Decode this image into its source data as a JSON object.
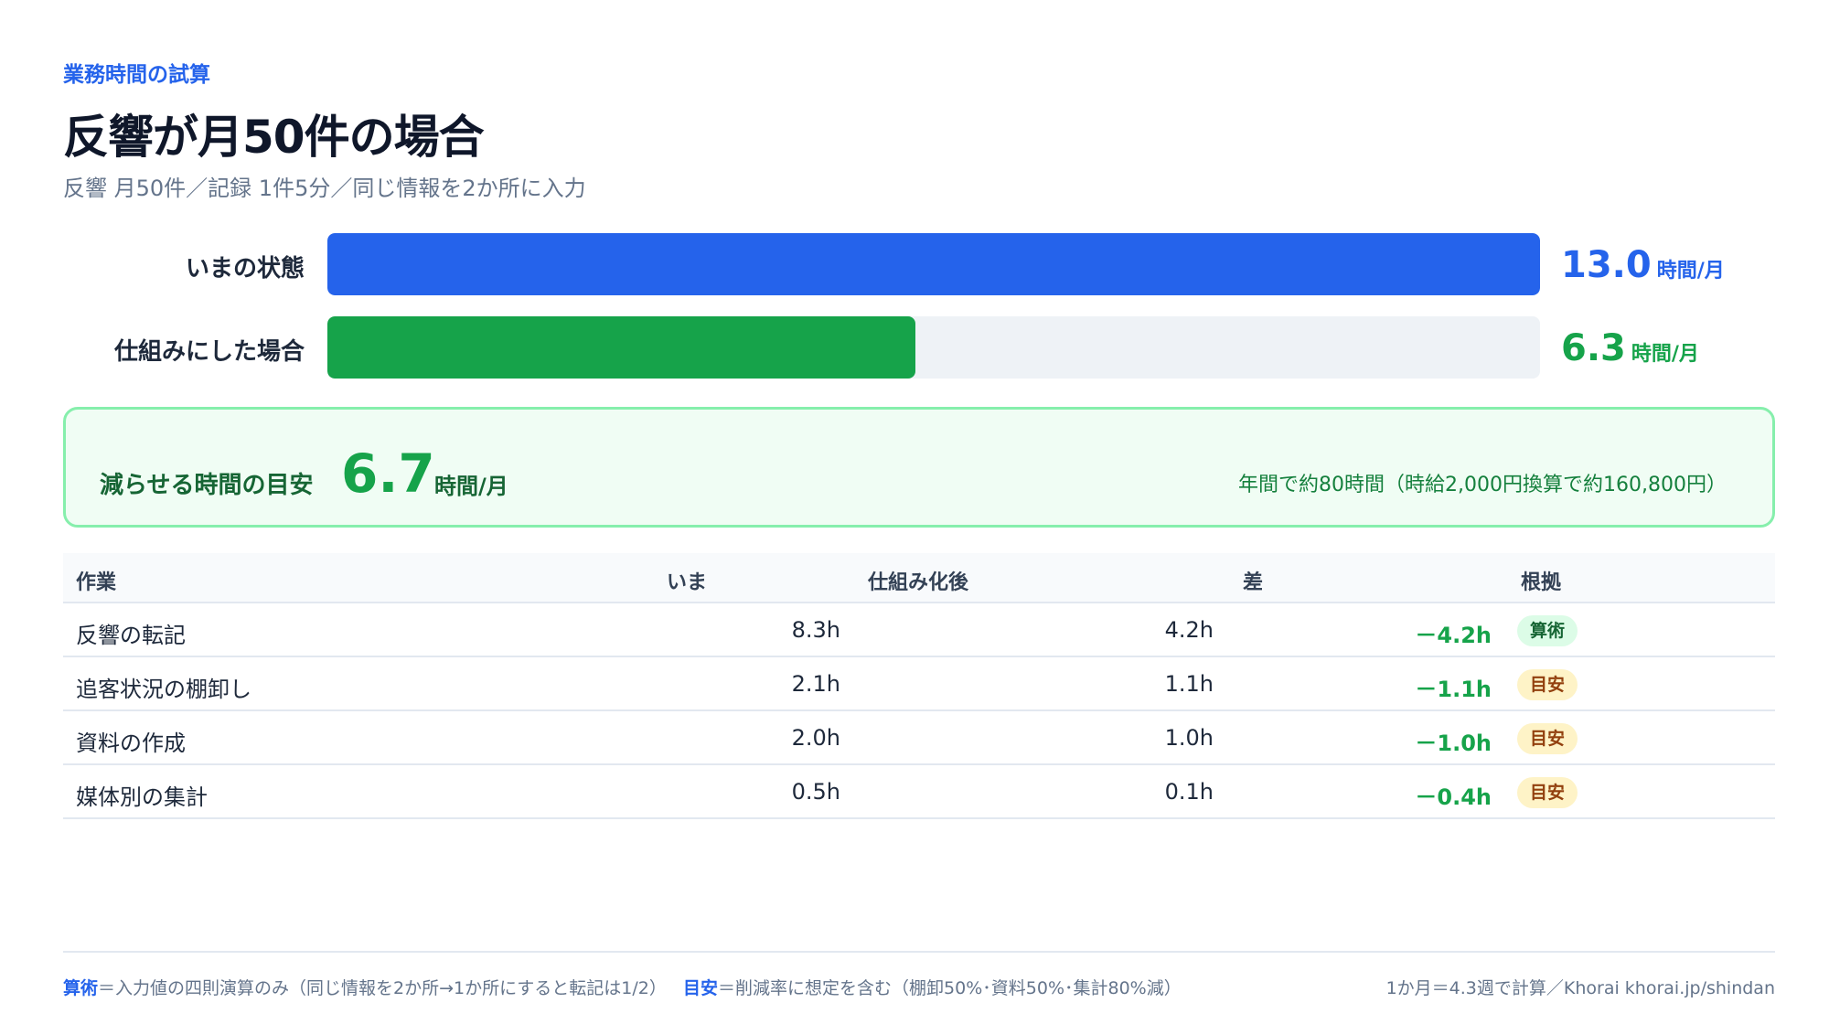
{
  "header": {
    "eyebrow": "業務時間の試算",
    "title": "反響が月50件の場合",
    "subtitle": "反響 月50件／記録 1件5分／同じ情報を2か所に入力"
  },
  "bars": [
    {
      "label": "いまの状態",
      "value": "13.0",
      "unit": "時間/月",
      "fraction": 1.0,
      "color": "#2563eb"
    },
    {
      "label": "仕組みにした場合",
      "value": "6.3",
      "unit": "時間/月",
      "fraction": 0.4846,
      "color": "#16a34a"
    }
  ],
  "summary": {
    "label": "減らせる時間の目安",
    "value": "6.7",
    "unit": "時間/月",
    "note": "年間で約80時間（時給2,000円換算で約160,800円）"
  },
  "table": {
    "headers": {
      "task": "作業",
      "now": "いま",
      "after": "仕組み化後",
      "diff": "差",
      "basis": "根拠"
    },
    "rows": [
      {
        "task": "反響の転記",
        "now": "8.3h",
        "after": "4.2h",
        "diff": "－4.2h",
        "basis": "算術",
        "basis_type": "calc"
      },
      {
        "task": "追客状況の棚卸し",
        "now": "2.1h",
        "after": "1.1h",
        "diff": "－1.1h",
        "basis": "目安",
        "basis_type": "est"
      },
      {
        "task": "資料の作成",
        "now": "2.0h",
        "after": "1.0h",
        "diff": "－1.0h",
        "basis": "目安",
        "basis_type": "est"
      },
      {
        "task": "媒体別の集計",
        "now": "0.5h",
        "after": "0.1h",
        "diff": "－0.4h",
        "basis": "目安",
        "basis_type": "est"
      }
    ]
  },
  "badge_colors": {
    "calc": {
      "bg": "#dcfce7",
      "fg": "#166534"
    },
    "est": {
      "bg": "#fef3c7",
      "fg": "#92400e"
    }
  },
  "footer": {
    "calc_key": "算術",
    "calc_desc": "＝入力値の四則演算のみ（同じ情報を2か所→1か所にすると転記は1/2）",
    "est_key": "目安",
    "est_desc": "＝削減率に想定を含む（棚卸50%･資料50%･集計80%減）",
    "right": "1か月＝4.3週で計算／Khorai khorai.jp/shindan"
  }
}
